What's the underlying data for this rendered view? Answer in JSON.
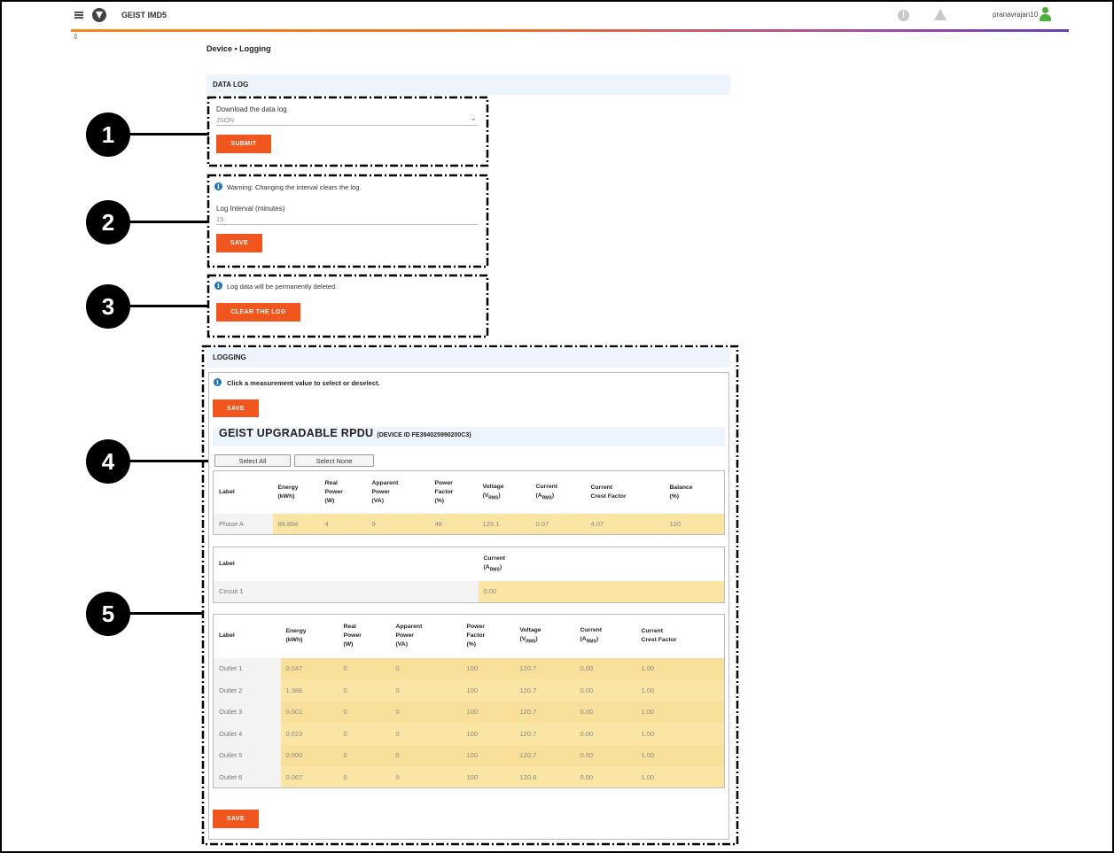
{
  "app": {
    "brand": "GEIST IMD5",
    "username": "pranavrajan10",
    "alert_icon": "alert-circle-icon",
    "warning_icon": "warning-triangle-icon",
    "gradient_colors": [
      "#f08a1c",
      "#6c3fb5"
    ]
  },
  "breadcrumb": "Device • Logging",
  "data_log": {
    "header": "DATA LOG",
    "download": {
      "label": "Download the data log",
      "value": "JSON",
      "submit": "SUBMIT"
    },
    "interval": {
      "warning": "Warning: Changing the interval clears the log.",
      "label": "Log Interval (minutes)",
      "value": "15",
      "save": "SAVE"
    },
    "clear": {
      "info": "Log data will be permanently deleted.",
      "button": "CLEAR THE LOG"
    }
  },
  "logging": {
    "header": "LOGGING",
    "info": "Click a measurement value to select or deselect.",
    "save_top": "SAVE",
    "save_bottom": "SAVE",
    "device_name": "GEIST UPGRADABLE RPDU",
    "device_id": "(DEVICE ID FE394025990200C3)",
    "select_all": "Select All",
    "select_none": "Select None",
    "phase_table": {
      "headers": [
        "Label",
        "Energy (kWh)",
        "Real Power (W)",
        "Apparent Power (VA)",
        "Power Factor (%)",
        "Voltage (VRMS)",
        "Current (ARMS)",
        "Current Crest Factor",
        "Balance (%)"
      ],
      "rows": [
        [
          "Phase A",
          "88.884",
          "4",
          "9",
          "48",
          "125.1",
          "0.07",
          "4.07",
          "100"
        ]
      ]
    },
    "circuit_table": {
      "headers": [
        "Label",
        "Current (ARMS)"
      ],
      "rows": [
        [
          "Circuit 1",
          "0.00"
        ]
      ]
    },
    "outlet_table": {
      "headers": [
        "Label",
        "Energy (kWh)",
        "Real Power (W)",
        "Apparent Power (VA)",
        "Power Factor (%)",
        "Voltage (VRMS)",
        "Current (ARMS)",
        "Current Crest Factor"
      ],
      "rows": [
        [
          "Outlet 1",
          "0.047",
          "0",
          "0",
          "100",
          "120.7",
          "0.00",
          "1.00"
        ],
        [
          "Outlet 2",
          "1.386",
          "0",
          "0",
          "100",
          "120.7",
          "0.00",
          "1.00"
        ],
        [
          "Outlet 3",
          "0.001",
          "0",
          "0",
          "100",
          "120.7",
          "0.00",
          "1.00"
        ],
        [
          "Outlet 4",
          "0.023",
          "0",
          "0",
          "100",
          "120.7",
          "0.00",
          "1.00"
        ],
        [
          "Outlet 5",
          "0.000",
          "0",
          "0",
          "100",
          "120.7",
          "0.00",
          "1.00"
        ],
        [
          "Outlet 6",
          "0.067",
          "0",
          "0",
          "100",
          "120.8",
          "0.00",
          "1.00"
        ]
      ]
    }
  },
  "callouts": [
    "1",
    "2",
    "3",
    "4",
    "5"
  ]
}
